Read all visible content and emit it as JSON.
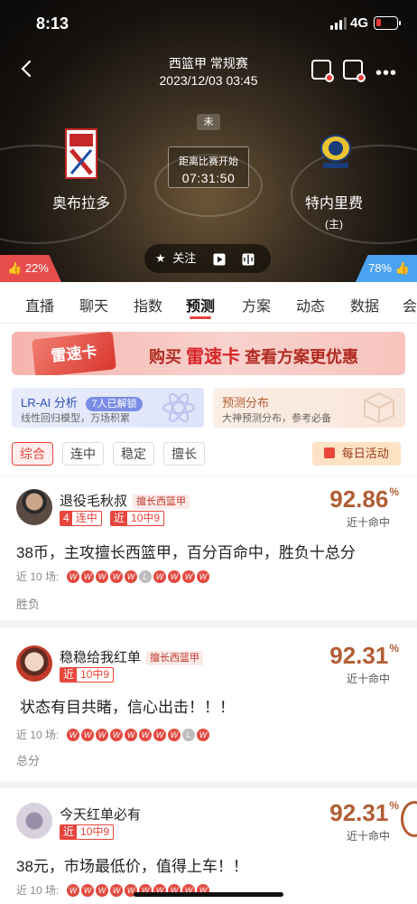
{
  "status_bar": {
    "time": "8:13",
    "network": "4G"
  },
  "header": {
    "league": "西篮甲 常规赛",
    "datetime": "2023/12/03 03:45"
  },
  "match": {
    "status": "未",
    "countdown_label": "距离比赛开始",
    "countdown_value": "07:31:50",
    "home": {
      "name": "奥布拉多"
    },
    "away": {
      "name": "特内里费",
      "note": "(主)"
    }
  },
  "actions": {
    "follow": "关注"
  },
  "votes": {
    "left": "22%",
    "right": "78%"
  },
  "tabs": [
    {
      "label": "直播"
    },
    {
      "label": "聊天"
    },
    {
      "label": "指数"
    },
    {
      "label": "预测"
    },
    {
      "label": "方案"
    },
    {
      "label": "动态"
    },
    {
      "label": "数据"
    },
    {
      "label": "会"
    }
  ],
  "banner": {
    "card": "雷速卡",
    "prefix": "购买",
    "highlight": "雷速卡",
    "suffix": "查看方案更优惠"
  },
  "feature_cards": {
    "ai": {
      "title": "LR-AI 分析",
      "badge": "7人已解锁",
      "sub": "线性回归模型，万场积累"
    },
    "dist": {
      "title": "预测分布",
      "sub": "大神预测分布，参考必备"
    }
  },
  "filters": [
    "综合",
    "连中",
    "稳定",
    "擅长"
  ],
  "daily_activity": "每日活动",
  "posts": [
    {
      "name": "退役毛秋叔",
      "tag": "擅长西篮甲",
      "badges": [
        {
          "k": "4",
          "v": "连中"
        },
        {
          "k": "近",
          "v": "10中9"
        }
      ],
      "rate": "92.86",
      "rate_unit": "%",
      "rate_label": "近十命中",
      "content": "38币，主攻擅长西篮甲，百分百命中，胜负十总分",
      "recent_label": "近 10 场:",
      "results": [
        "W",
        "W",
        "W",
        "W",
        "W",
        "L",
        "W",
        "W",
        "W",
        "W"
      ],
      "kind": "胜负"
    },
    {
      "name": "稳稳给我红单",
      "tag": "擅长西篮甲",
      "badges": [
        {
          "k": "近",
          "v": "10中9"
        }
      ],
      "rate": "92.31",
      "rate_unit": "%",
      "rate_label": "近十命中",
      "content": "状态有目共睹，信心出击！！！",
      "recent_label": "近 10 场:",
      "results": [
        "W",
        "W",
        "W",
        "W",
        "W",
        "W",
        "W",
        "W",
        "L",
        "W"
      ],
      "kind": "总分"
    },
    {
      "name": "今天红单必有",
      "tag": "",
      "badges": [
        {
          "k": "近",
          "v": "10中9"
        }
      ],
      "rate": "92.31",
      "rate_unit": "%",
      "rate_label": "近十命中",
      "content": "38元，市场最低价，值得上车！！",
      "recent_label": "近 10 场:",
      "results": [
        "W",
        "W",
        "W",
        "W",
        "W",
        "W",
        "W",
        "W",
        "W",
        "W"
      ],
      "kind": ""
    }
  ],
  "colors": {
    "accent": "#e8453c",
    "rate": "#b25d34",
    "vote_left": "#e84d4d",
    "vote_right": "#4aa3f0"
  }
}
